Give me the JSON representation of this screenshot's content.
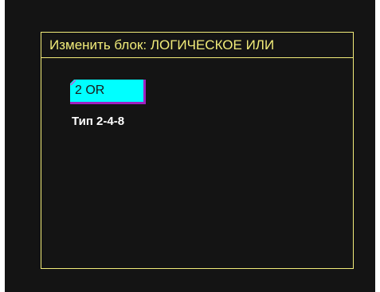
{
  "dialog": {
    "title": "Изменить блок:  ЛОГИЧЕСКОЕ ИЛИ"
  },
  "block": {
    "button_label": "2 OR",
    "type_label": "Тип 2-4-8"
  },
  "colors": {
    "frame": "#f2ec7a",
    "button_bg": "#00ffff",
    "button_border": "#a020c0",
    "screen_bg": "#141414"
  }
}
